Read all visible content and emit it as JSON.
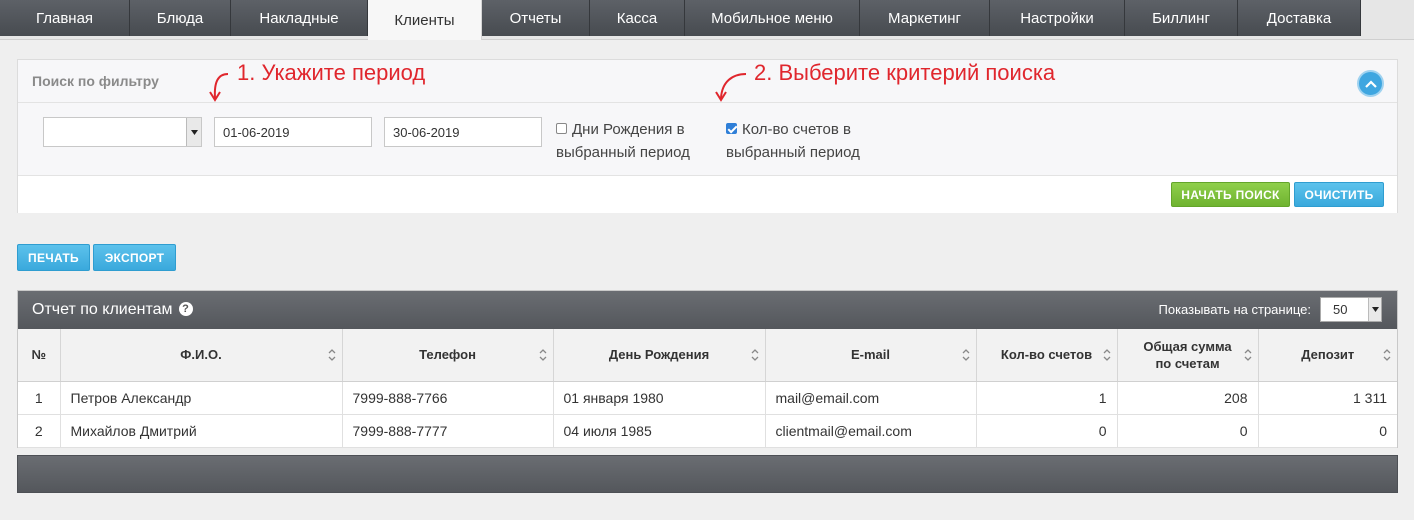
{
  "nav": {
    "tabs": [
      "Главная",
      "Блюда",
      "Накладные",
      "Клиенты",
      "Отчеты",
      "Касса",
      "Мобильное меню",
      "Маркетинг",
      "Настройки",
      "Биллинг",
      "Доставка"
    ],
    "active": "Клиенты"
  },
  "filter": {
    "title": "Поиск по фильтру",
    "select_value": "",
    "date_from": "01-06-2019",
    "date_to": "30-06-2019",
    "birthdays_label_1": "Дни Рождения в",
    "birthdays_label_2": "выбранный период",
    "birthdays_checked": false,
    "bills_label_1": "Кол-во счетов в",
    "bills_label_2": "выбранный период",
    "bills_checked": true,
    "search_button": "Начать поиск",
    "clear_button": "Очистить"
  },
  "annotations": {
    "step1": "1. Укажите период",
    "step2": "2. Выберите критерий поиска"
  },
  "actions": {
    "print": "Печать",
    "export": "Экспорт"
  },
  "report": {
    "title": "Отчет по клиентам",
    "help": "?",
    "per_page_label": "Показывать на странице:",
    "per_page_value": "50",
    "columns": [
      "№",
      "Ф.И.О.",
      "Телефон",
      "День Рождения",
      "E-mail",
      "Кол-во счетов",
      "Общая сумма по счетам",
      "Депозит"
    ],
    "columns_wrapped": {
      "total_1": "Общая сумма",
      "total_2": "по счетам"
    },
    "rows": [
      {
        "no": "1",
        "name": "Петров Александр",
        "phone": "7999-888-7766",
        "birthday": "01 января 1980",
        "email": "mail@email.com",
        "bills": "1",
        "total": "208",
        "deposit": "1 311"
      },
      {
        "no": "2",
        "name": "Михайлов Дмитрий",
        "phone": "7999-888-7777",
        "birthday": "04 июля 1985",
        "email": "clientmail@email.com",
        "bills": "0",
        "total": "0",
        "deposit": "0"
      }
    ]
  },
  "colors": {
    "annotation": "#e0262d",
    "green_button": "#7cc13c",
    "blue_button": "#45b0e1",
    "header_dark": "#5e6166"
  }
}
